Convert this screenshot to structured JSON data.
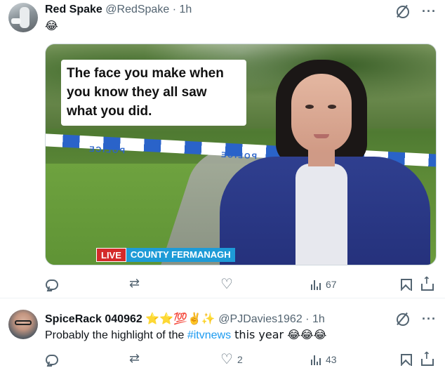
{
  "tweets": [
    {
      "display_name": "Red Spake",
      "handle": "@RedSpake",
      "separator": "·",
      "time": "1h",
      "text": "😂",
      "media": {
        "caption": "The face you make when you know they all saw what you did.",
        "tape_text": "POLICE",
        "live_label": "LIVE",
        "location_label": "COUNTY FERMANAGH"
      },
      "stats": {
        "replies": "",
        "retweets": "",
        "likes": "",
        "views": "67"
      }
    },
    {
      "display_name": "SpiceRack 040962",
      "name_emojis": "⭐⭐💯✌️✨",
      "handle": "@PJDavies1962",
      "separator": "·",
      "time": "1h",
      "text_before": "Probably the highlight of the ",
      "hashtag": "#itvnews",
      "text_after": " this year 😂😂😂",
      "stats": {
        "replies": "",
        "retweets": "",
        "likes": "2",
        "views": "43"
      }
    }
  ],
  "icons": {
    "grok": "grok-icon",
    "more": "more-icon",
    "reply": "reply-icon",
    "retweet": "retweet-icon",
    "like": "like-icon",
    "views": "views-icon",
    "bookmark": "bookmark-icon",
    "share": "share-icon"
  },
  "colors": {
    "accent": "#1d9bf0",
    "muted": "#536471",
    "live_red": "#d42a2a",
    "location_blue": "#1e9bd7"
  }
}
